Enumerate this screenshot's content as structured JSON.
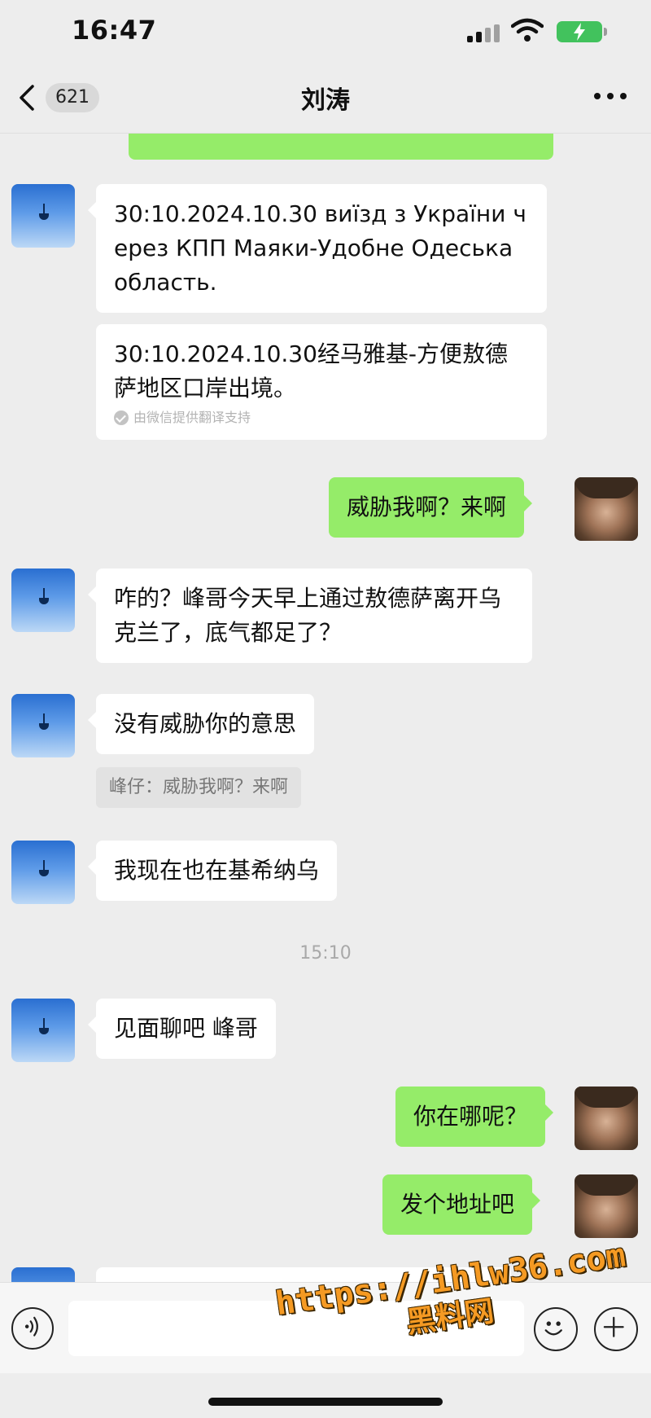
{
  "status_bar": {
    "time": "16:47"
  },
  "header": {
    "back_badge": "621",
    "title": "刘涛"
  },
  "messages": [
    {
      "side": "left",
      "text": "30:10.2024.10.30 виїзд з України ч ерез КПП Маяки-Удобне Одеська область."
    },
    {
      "side": "left",
      "text": "30:10.2024.10.30经马雅基-方便敖德萨地区口岸出境。",
      "note": "由微信提供翻译支持"
    },
    {
      "side": "right",
      "text": "威胁我啊？来啊"
    },
    {
      "side": "left",
      "text": "咋的？峰哥今天早上通过敖德萨离开乌克兰了，底气都足了？"
    },
    {
      "side": "left",
      "text": "没有威胁你的意思",
      "quote": "峰仔：威胁我啊？来啊"
    },
    {
      "side": "left",
      "text": "我现在也在基希纳乌"
    },
    {
      "type": "time",
      "text": "15:10"
    },
    {
      "side": "left",
      "text": "见面聊吧 峰哥"
    },
    {
      "side": "right",
      "text": "你在哪呢？"
    },
    {
      "side": "right",
      "text": "发个地址吧"
    }
  ],
  "watermark": {
    "url": "https://ihlw36.com",
    "sub": "黑料网"
  },
  "colors": {
    "sent_bubble": "#95ec69",
    "received_bubble": "#ffffff",
    "background": "#ededed"
  }
}
